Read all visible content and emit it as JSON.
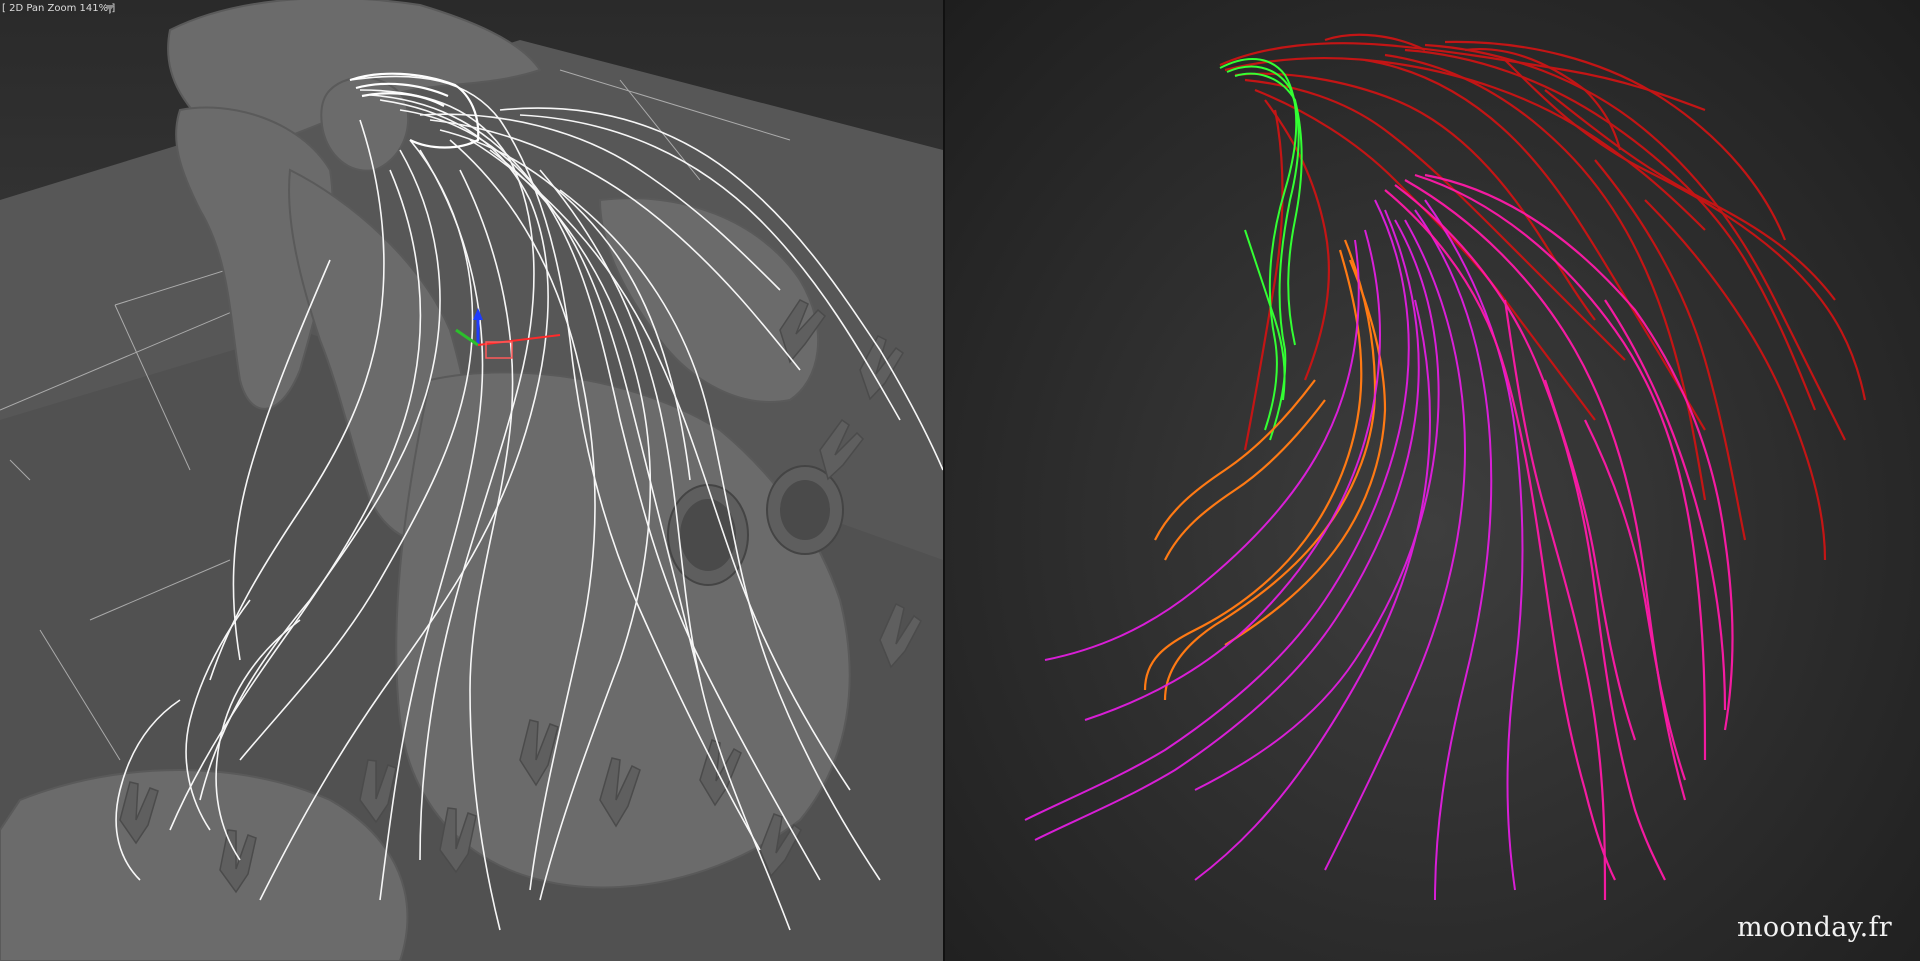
{
  "viewport": {
    "label": "[ 2D Pan Zoom 141% ]",
    "filter_icon": "funnel-icon"
  },
  "watermark": "moonday.fr",
  "colors": {
    "hair_wire": "#ffffff",
    "guide_green": "#33ff33",
    "guide_red": "#cc1414",
    "guide_orange": "#ff7a14",
    "guide_magenta": "#e21ee0",
    "guide_pink": "#ff1aa8",
    "gizmo_blue": "#1e3cff",
    "gizmo_red": "#ff2b2b"
  }
}
